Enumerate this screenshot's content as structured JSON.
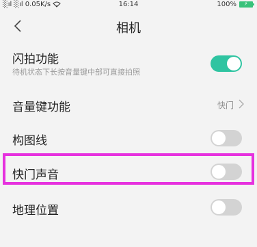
{
  "status_bar": {
    "signal": "░ıl ░ıl",
    "speed": "0.05K/s",
    "time": "16:14",
    "battery": "100%"
  },
  "header": {
    "title": "相机"
  },
  "settings": {
    "snapshot": {
      "label": "闪拍功能",
      "description": "待机状态下长按音量键中部可直接拍照",
      "toggle_state": "on"
    },
    "volume_key": {
      "label": "音量键功能",
      "value": "快门"
    },
    "grid_lines": {
      "label": "构图线",
      "toggle_state": "off"
    },
    "shutter_sound": {
      "label": "快门声音",
      "toggle_state": "off"
    },
    "location": {
      "label": "地理位置",
      "toggle_state": "off"
    }
  },
  "colors": {
    "toggle_on": "#2fc4a1",
    "toggle_off": "#d3d3d3",
    "highlight": "#e631de"
  }
}
